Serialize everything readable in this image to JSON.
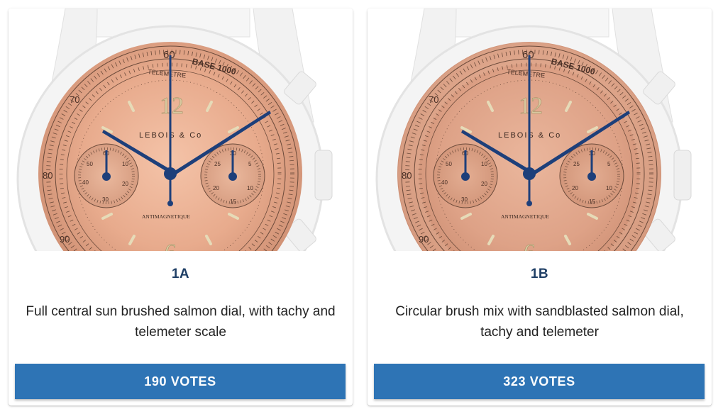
{
  "options": [
    {
      "code": "1A",
      "description": "Full central sun brushed salmon dial, with tachy and telemeter scale",
      "votes_label": "190 VOTES",
      "votes": 190,
      "brand": "LEBOIS & Co",
      "dial_text": "ANTIMAGNETIQUE",
      "scale_top": "BASE 1000",
      "scale_label": "TELEMETRE",
      "dial_finish": "sunburst",
      "dial_color": "#e5a98c"
    },
    {
      "code": "1B",
      "description": "Circular brush mix with sandblasted salmon dial, tachy and telemeter",
      "votes_label": "323 VOTES",
      "votes": 323,
      "brand": "LEBOIS & Co",
      "dial_text": "ANTIMAGNETIQUE",
      "scale_top": "BASE 1000",
      "scale_label": "TELEMETRE",
      "dial_finish": "sandblasted",
      "dial_color": "#dea287"
    }
  ],
  "colors": {
    "button": "#2e74b5",
    "code_text": "#1f3f66",
    "hands": "#1d3f7a"
  }
}
